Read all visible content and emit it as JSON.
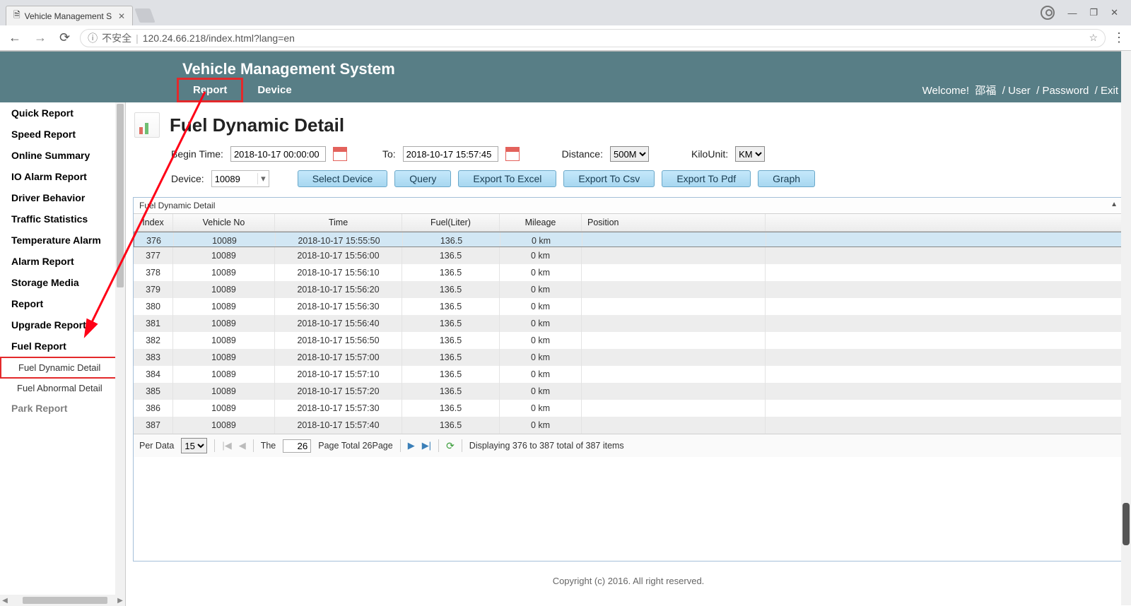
{
  "browser": {
    "tab_title": "Vehicle Management S",
    "url_insecure": "不安全",
    "url": "120.24.66.218/index.html?lang=en",
    "info_icon": "ⓘ"
  },
  "header": {
    "title": "Vehicle Management System",
    "nav": {
      "report": "Report",
      "device": "Device"
    },
    "welcome_prefix": "Welcome!",
    "username": "邵福",
    "links": {
      "user": "User",
      "password": "Password",
      "exit": "Exit"
    }
  },
  "sidebar": {
    "items": [
      "Quick Report",
      "Speed Report",
      "Online Summary",
      "IO Alarm Report",
      "Driver Behavior",
      "Traffic Statistics",
      "Temperature Alarm",
      "Alarm Report",
      "Storage Media",
      "Report",
      "Upgrade Report",
      "Fuel Report"
    ],
    "sub": {
      "active": "Fuel Dynamic Detail",
      "other": "Fuel Abnormal Detail"
    },
    "cutoff": "Park Report"
  },
  "page": {
    "title": "Fuel Dynamic Detail",
    "filters": {
      "begin_label": "Begin Time:",
      "begin_value": "2018-10-17 00:00:00",
      "to_label": "To:",
      "to_value": "2018-10-17 15:57:45",
      "distance_label": "Distance:",
      "distance_value": "500M",
      "kilounit_label": "KiloUnit:",
      "kilounit_value": "KM",
      "device_label": "Device:",
      "device_value": "10089"
    },
    "buttons": {
      "select_device": "Select Device",
      "query": "Query",
      "export_excel": "Export To Excel",
      "export_csv": "Export To Csv",
      "export_pdf": "Export To Pdf",
      "graph": "Graph"
    }
  },
  "grid": {
    "panel_title": "Fuel Dynamic Detail",
    "columns": {
      "index": "Index",
      "vehicle": "Vehicle No",
      "time": "Time",
      "fuel": "Fuel(Liter)",
      "mileage": "Mileage",
      "position": "Position"
    },
    "rows": [
      {
        "idx": "376",
        "veh": "10089",
        "time": "2018-10-17 15:55:50",
        "fuel": "136.5",
        "mil": "0 km",
        "pos": ""
      },
      {
        "idx": "377",
        "veh": "10089",
        "time": "2018-10-17 15:56:00",
        "fuel": "136.5",
        "mil": "0 km",
        "pos": ""
      },
      {
        "idx": "378",
        "veh": "10089",
        "time": "2018-10-17 15:56:10",
        "fuel": "136.5",
        "mil": "0 km",
        "pos": ""
      },
      {
        "idx": "379",
        "veh": "10089",
        "time": "2018-10-17 15:56:20",
        "fuel": "136.5",
        "mil": "0 km",
        "pos": ""
      },
      {
        "idx": "380",
        "veh": "10089",
        "time": "2018-10-17 15:56:30",
        "fuel": "136.5",
        "mil": "0 km",
        "pos": ""
      },
      {
        "idx": "381",
        "veh": "10089",
        "time": "2018-10-17 15:56:40",
        "fuel": "136.5",
        "mil": "0 km",
        "pos": ""
      },
      {
        "idx": "382",
        "veh": "10089",
        "time": "2018-10-17 15:56:50",
        "fuel": "136.5",
        "mil": "0 km",
        "pos": ""
      },
      {
        "idx": "383",
        "veh": "10089",
        "time": "2018-10-17 15:57:00",
        "fuel": "136.5",
        "mil": "0 km",
        "pos": ""
      },
      {
        "idx": "384",
        "veh": "10089",
        "time": "2018-10-17 15:57:10",
        "fuel": "136.5",
        "mil": "0 km",
        "pos": ""
      },
      {
        "idx": "385",
        "veh": "10089",
        "time": "2018-10-17 15:57:20",
        "fuel": "136.5",
        "mil": "0 km",
        "pos": ""
      },
      {
        "idx": "386",
        "veh": "10089",
        "time": "2018-10-17 15:57:30",
        "fuel": "136.5",
        "mil": "0 km",
        "pos": ""
      },
      {
        "idx": "387",
        "veh": "10089",
        "time": "2018-10-17 15:57:40",
        "fuel": "136.5",
        "mil": "0 km",
        "pos": ""
      }
    ]
  },
  "pager": {
    "per_data_label": "Per Data",
    "per_data_value": "15",
    "the_label": "The",
    "page_value": "26",
    "page_total_label": "Page  Total 26Page",
    "status": "Displaying 376 to 387 total of 387 items"
  },
  "footer": "Copyright (c) 2016. All right reserved."
}
